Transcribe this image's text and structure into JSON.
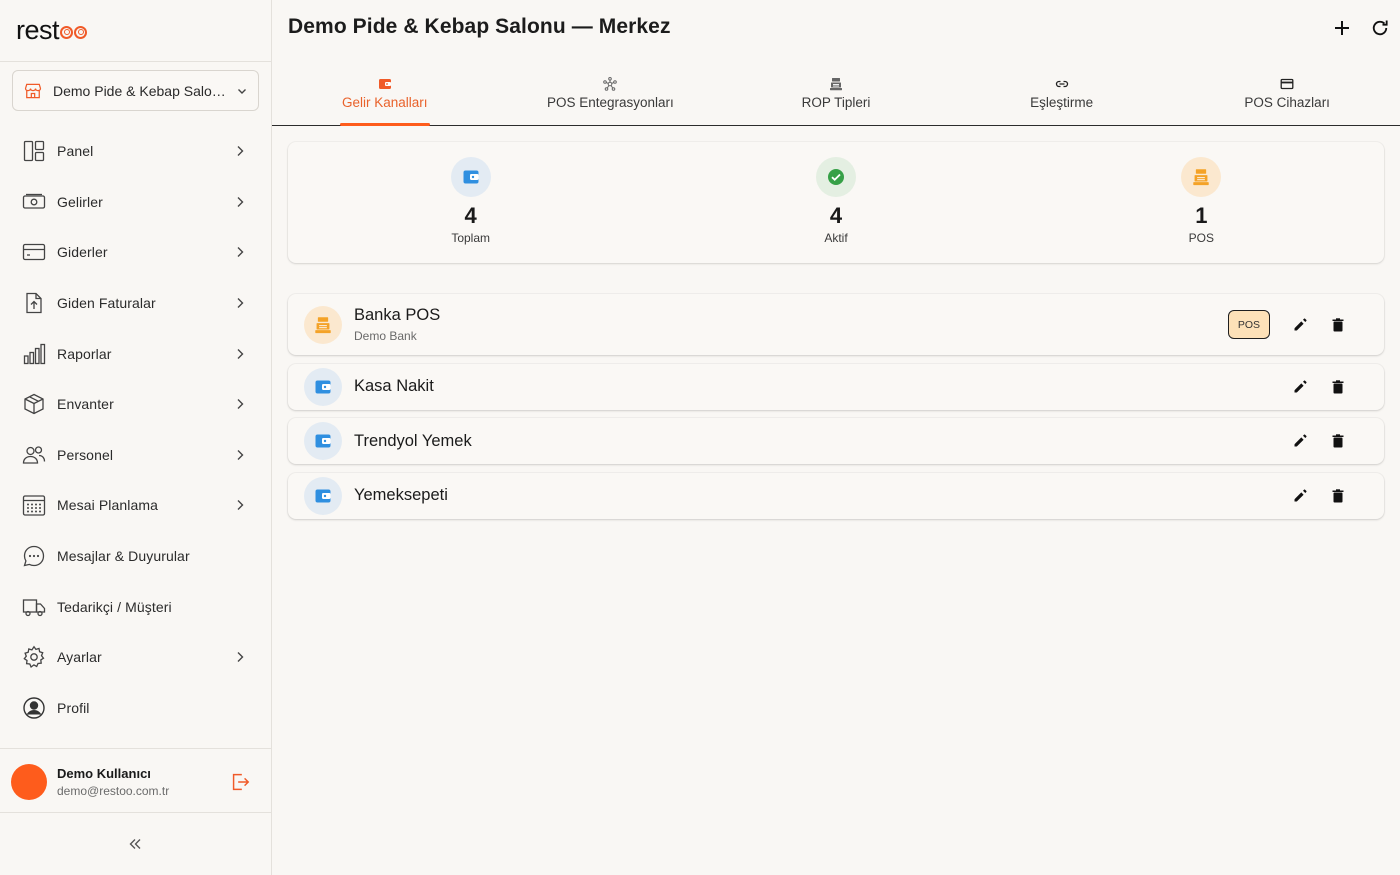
{
  "app": {
    "logo_text_prefix": "rest",
    "accent_color": "#fe5c1c"
  },
  "sidebar": {
    "branch_selector": {
      "label": "Demo Pide & Kebap Salonu — Merkez",
      "icon": "store-icon"
    },
    "items": [
      {
        "label": "Panel",
        "icon": "dashboard-icon",
        "has_arrow": true
      },
      {
        "label": "Gelirler",
        "icon": "cash-icon",
        "has_arrow": true
      },
      {
        "label": "Giderler",
        "icon": "credit-card-icon",
        "has_arrow": true
      },
      {
        "label": "Giden Faturalar",
        "icon": "invoice-upload-icon",
        "has_arrow": true
      },
      {
        "label": "Raporlar",
        "icon": "bar-chart-icon",
        "has_arrow": true
      },
      {
        "label": "Envanter",
        "icon": "box-icon",
        "has_arrow": true
      },
      {
        "label": "Personel",
        "icon": "people-icon",
        "has_arrow": true
      },
      {
        "label": "Mesai Planlama",
        "icon": "calendar-icon",
        "has_arrow": true
      },
      {
        "label": "Mesajlar & Duyurular",
        "icon": "chat-icon",
        "has_arrow": false
      },
      {
        "label": "Tedarikçi / Müşteri",
        "icon": "truck-icon",
        "has_arrow": false
      },
      {
        "label": "Ayarlar",
        "icon": "gear-icon",
        "has_arrow": true
      },
      {
        "label": "Profil",
        "icon": "user-circle-icon",
        "has_arrow": false
      }
    ],
    "user": {
      "name": "Demo Kullanıcı",
      "email": "demo@restoo.com.tr"
    }
  },
  "header": {
    "title": "Demo Pide & Kebap Salonu — Merkez"
  },
  "tabs": [
    {
      "label": "Gelir Kanalları",
      "active": true,
      "icon": "wallet-icon"
    },
    {
      "label": "POS Entegrasyonları",
      "active": false,
      "icon": "hub-icon"
    },
    {
      "label": "ROP Tipleri",
      "active": false,
      "icon": "register-icon"
    },
    {
      "label": "Eşleştirme",
      "active": false,
      "icon": "link-icon"
    },
    {
      "label": "POS Cihazları",
      "active": false,
      "icon": "card-icon"
    }
  ],
  "stats": [
    {
      "value": "4",
      "label": "Toplam",
      "icon": "wallet-icon",
      "bg": "#e3ebf3"
    },
    {
      "value": "4",
      "label": "Aktif",
      "icon": "check-circle-icon",
      "bg": "#e4efe2"
    },
    {
      "value": "1",
      "label": "POS",
      "icon": "register-icon",
      "bg": "#fbe8cf"
    }
  ],
  "channels": [
    {
      "name": "Banka POS",
      "subtitle": "Demo Bank",
      "type": "pos",
      "badge": "POS"
    },
    {
      "name": "Kasa Nakit",
      "subtitle": "",
      "type": "wallet",
      "badge": ""
    },
    {
      "name": "Trendyol Yemek",
      "subtitle": "",
      "type": "wallet",
      "badge": ""
    },
    {
      "name": "Yemeksepeti",
      "subtitle": "",
      "type": "wallet",
      "badge": ""
    }
  ]
}
